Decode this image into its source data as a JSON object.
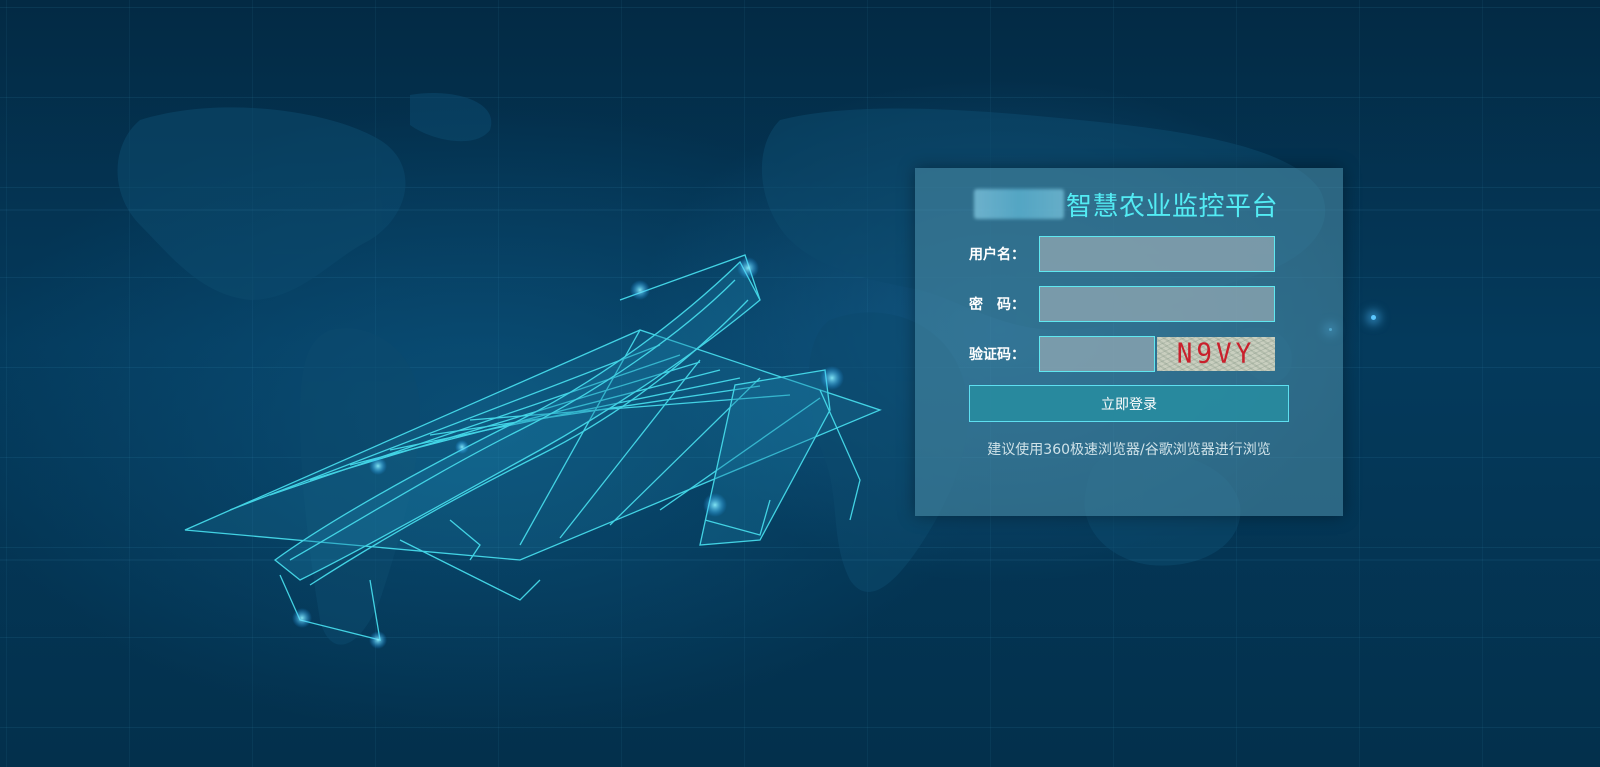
{
  "login": {
    "title": "智慧农业监控平台",
    "username_label": "用户名：",
    "username_value": "",
    "password_label": "密　码：",
    "password_value": "",
    "captcha_label": "验证码：",
    "captcha_value": "",
    "captcha_text": "N9VY",
    "submit_label": "立即登录",
    "browser_hint": "建议使用360极速浏览器/谷歌浏览器进行浏览"
  },
  "colors": {
    "background": "#03304c",
    "title": "#53ecf4",
    "input_border": "#60e8f0",
    "button": "#288ca0",
    "captcha_text": "#c9202c"
  },
  "icons": {
    "background_map": "world-map",
    "illustration": "drone-wireframe"
  }
}
